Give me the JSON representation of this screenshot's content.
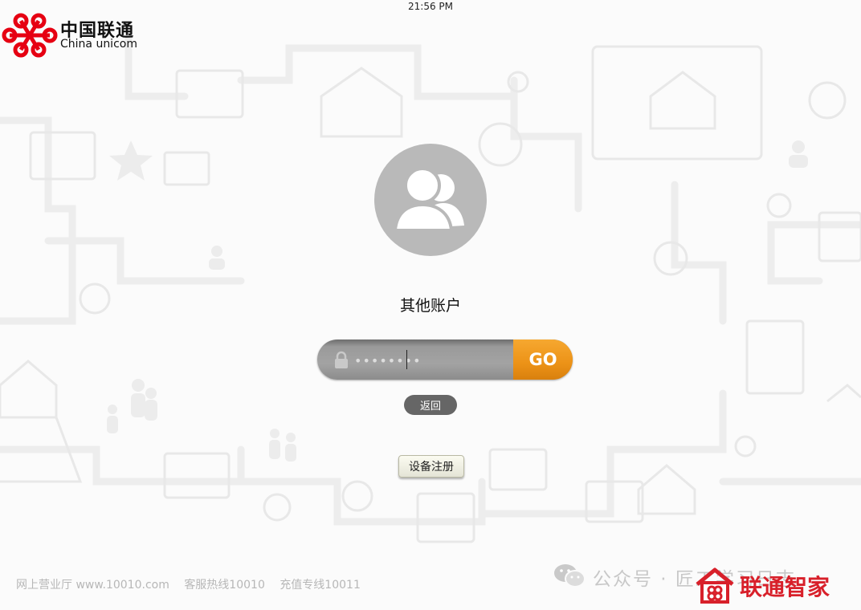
{
  "status_bar": {
    "time": "21:56 PM"
  },
  "brand": {
    "name_cn": "中国联通",
    "name_en": "China unicom",
    "color": "#e60012"
  },
  "login": {
    "account_label": "其他账户",
    "password_value": "••••••••",
    "go_label": "GO",
    "go_color": "#ec9217",
    "back_label": "返回",
    "register_label": "设备注册"
  },
  "footer": {
    "items": [
      "网上营业厅 www.10010.com",
      "客服热线10010",
      "充值专线10011"
    ]
  },
  "watermark": {
    "wechat_text": "公众号 · 匠工学习日志",
    "brand_text": "联通智家"
  },
  "icons": {
    "lock": "lock-icon",
    "avatar": "user-avatar-icon",
    "wechat": "wechat-icon",
    "brand": "unicom-knot-icon"
  }
}
